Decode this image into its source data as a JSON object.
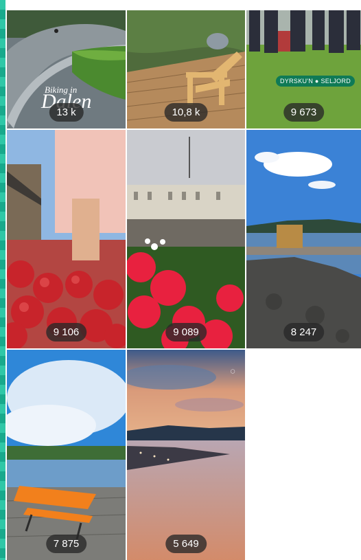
{
  "reels": [
    {
      "id": "biking-in-dalen",
      "overlay_line1": "Biking in",
      "overlay_line2": "Dalen",
      "views": "13 k"
    },
    {
      "id": "wooden-deck-chair",
      "views": "10,8 k"
    },
    {
      "id": "dyrskun-seljord",
      "overlay_tag": "DYRSKU'N ● SELJORD",
      "views": "9 673"
    },
    {
      "id": "apple-harvest",
      "views": "9 106"
    },
    {
      "id": "town-square-flowers",
      "views": "9 089"
    },
    {
      "id": "lake-sauna-pier",
      "views": "8 247"
    },
    {
      "id": "bench-by-lake",
      "views": "7 875"
    },
    {
      "id": "sunset-over-fjord",
      "views": "5 649"
    }
  ],
  "colors": {
    "edge": "#2fc7a7",
    "badge_bg": "#282828",
    "tag_bg": "#0f7a56"
  }
}
